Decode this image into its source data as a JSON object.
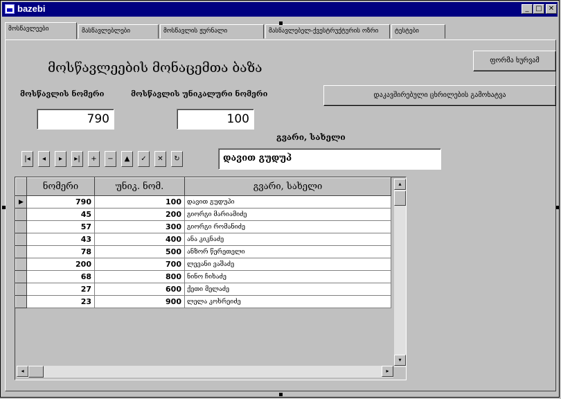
{
  "window": {
    "title": "bazebi",
    "controls": [
      "_",
      "□",
      "✕"
    ]
  },
  "tabs": [
    {
      "label": "მოსწავლეები"
    },
    {
      "label": "მასწავლებლები"
    },
    {
      "label": "მოსწავლის ჟურნალი"
    },
    {
      "label": "მასწავლებელ-ქვესტრუქტურის ოზრი"
    },
    {
      "label": "ტესტები"
    }
  ],
  "form": {
    "heading": "მოსწავლეების მონაცემთა ბაზა",
    "label_student_number": "მოსწავლის ნომერი",
    "label_student_unique_number": "მოსწავლის უნიკალური ნომერი",
    "student_number_value": "790",
    "unique_number_value": "100",
    "label_surname_name": "გვარი, სახელი",
    "surname_name_value": "დავით გუდუპ",
    "close_button": "ფორმა ხურვამ",
    "show_button": "დაკავშირებული ცხრილების გამოხატვა"
  },
  "navigator": {
    "buttons": [
      {
        "name": "first-record-button",
        "glyph": "|◂"
      },
      {
        "name": "prior-record-button",
        "glyph": "◂"
      },
      {
        "name": "next-record-button",
        "glyph": "▸"
      },
      {
        "name": "last-record-button",
        "glyph": "▸|"
      },
      {
        "name": "insert-record-button",
        "glyph": "+"
      },
      {
        "name": "delete-record-button",
        "glyph": "−"
      },
      {
        "name": "edit-record-button",
        "glyph": "▲"
      },
      {
        "name": "post-record-button",
        "glyph": "✓"
      },
      {
        "name": "cancel-record-button",
        "glyph": "✕"
      },
      {
        "name": "refresh-record-button",
        "glyph": "↻"
      }
    ]
  },
  "table": {
    "columns": [
      "ნომერი",
      "უნიკ. ნომ.",
      "გვარი, სახელი"
    ],
    "rows": [
      {
        "num": "790",
        "code": "100",
        "name": "დავით გუდუპი"
      },
      {
        "num": "45",
        "code": "200",
        "name": "გიორგი მარიამიძე"
      },
      {
        "num": "57",
        "code": "300",
        "name": "გიორგი რომანიძე"
      },
      {
        "num": "43",
        "code": "400",
        "name": "ანა კიკნაძე"
      },
      {
        "num": "78",
        "code": "500",
        "name": "ანზორ წერეთელი"
      },
      {
        "num": "200",
        "code": "700",
        "name": "ლევანი ვაშაძე"
      },
      {
        "num": "68",
        "code": "800",
        "name": "ნინო ჩიხაძე"
      },
      {
        "num": "27",
        "code": "600",
        "name": "ქეთი მელაძე"
      },
      {
        "num": "23",
        "code": "900",
        "name": "ლელა კოხრეიძე"
      }
    ]
  }
}
